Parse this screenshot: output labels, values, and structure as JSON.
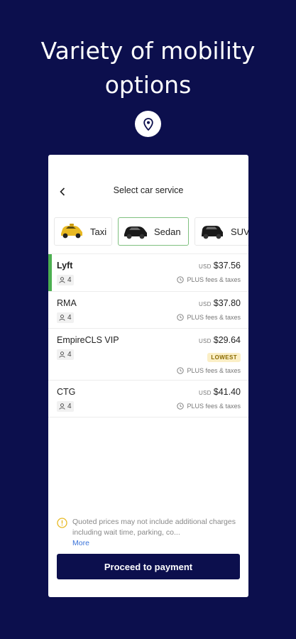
{
  "promo": {
    "headline_line1": "Variety of mobility",
    "headline_line2": "options"
  },
  "header": {
    "back_icon": "chevron-left-icon",
    "title": "Select car service"
  },
  "service_tabs": [
    {
      "label": "Taxi",
      "icon": "taxi-car-icon",
      "color": "#e8b923"
    },
    {
      "label": "Sedan",
      "icon": "sedan-car-icon",
      "color": "#1a1a1a",
      "active": true
    },
    {
      "label": "SUV",
      "icon": "suv-car-icon",
      "color": "#1a1a1a"
    }
  ],
  "rides": [
    {
      "name": "Lyft",
      "seats": "4",
      "currency": "USD",
      "price": "$37.56",
      "fees": "PLUS fees & taxes",
      "selected": true
    },
    {
      "name": "RMA",
      "seats": "4",
      "currency": "USD",
      "price": "$37.80",
      "fees": "PLUS fees & taxes"
    },
    {
      "name": "EmpireCLS VIP",
      "seats": "4",
      "currency": "USD",
      "price": "$29.64",
      "badge": "LOWEST",
      "fees": "PLUS fees & taxes"
    },
    {
      "name": "CTG",
      "seats": "4",
      "currency": "USD",
      "price": "$41.40",
      "fees": "PLUS fees & taxes"
    }
  ],
  "disclaimer": {
    "text": "Quoted prices may not include additional charges including wait time, parking, co...",
    "more": "More"
  },
  "actions": {
    "proceed_label": "Proceed to payment"
  },
  "colors": {
    "background": "#0c0f4d",
    "selected_accent": "#4caf50",
    "lowest_badge_bg": "#fbefc6",
    "link": "#3a73d9",
    "warning": "#e8b923"
  }
}
